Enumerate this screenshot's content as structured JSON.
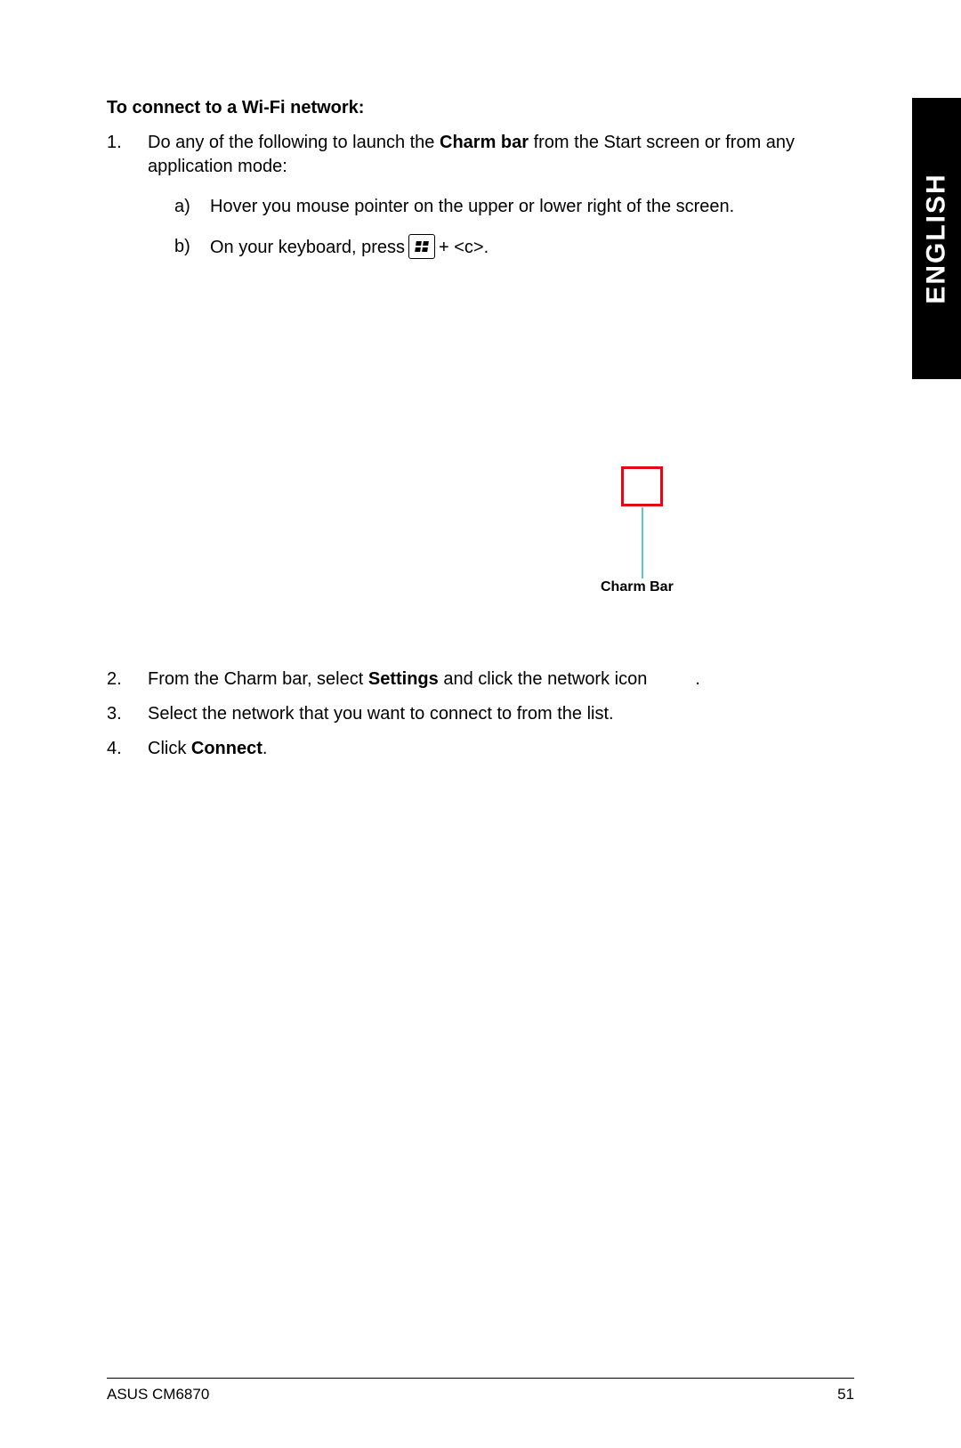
{
  "language_tab": "ENGLISH",
  "heading": "To connect to a Wi-Fi network:",
  "step1": {
    "num": "1.",
    "text_pre": "Do any of the following to launch the ",
    "bold": "Charm bar",
    "text_post": " from the Start screen or from any application mode:",
    "sub_a": {
      "letter": "a)",
      "text": "Hover you mouse pointer on the upper or lower right of the screen."
    },
    "sub_b": {
      "letter": "b)",
      "text_pre": "On your keyboard, press ",
      "text_post": " + <c>."
    }
  },
  "callout": "Charm Bar",
  "step2": {
    "num": "2.",
    "text_pre": "From the Charm bar, select ",
    "bold": "Settings",
    "text_post": " and click the network icon",
    "tail": "."
  },
  "step3": {
    "num": "3.",
    "text": "Select the network that you want to connect to from the list."
  },
  "step4": {
    "num": "4.",
    "text_pre": "Click ",
    "bold": "Connect",
    "tail": "."
  },
  "footer": {
    "product": "ASUS CM6870",
    "page": "51"
  }
}
